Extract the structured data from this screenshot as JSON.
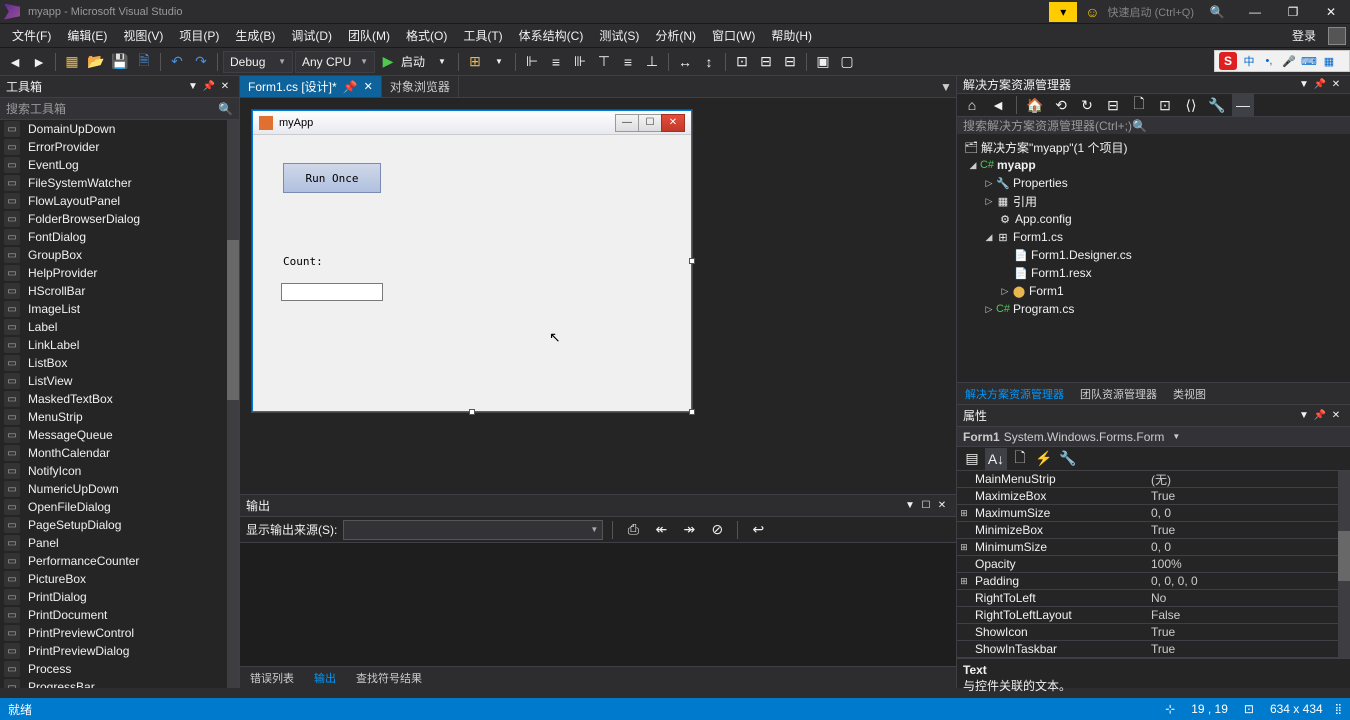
{
  "titlebar": {
    "title": "myapp - Microsoft Visual Studio",
    "quick_launch": "快速启动 (Ctrl+Q)"
  },
  "menu": {
    "items": [
      "文件(F)",
      "编辑(E)",
      "视图(V)",
      "项目(P)",
      "生成(B)",
      "调试(D)",
      "团队(M)",
      "格式(O)",
      "工具(T)",
      "体系结构(C)",
      "测试(S)",
      "分析(N)",
      "窗口(W)",
      "帮助(H)"
    ],
    "login": "登录"
  },
  "toolbar": {
    "config": "Debug",
    "platform": "Any CPU",
    "run": "启动"
  },
  "toolbox": {
    "header": "工具箱",
    "search": "搜索工具箱",
    "items": [
      "DomainUpDown",
      "ErrorProvider",
      "EventLog",
      "FileSystemWatcher",
      "FlowLayoutPanel",
      "FolderBrowserDialog",
      "FontDialog",
      "GroupBox",
      "HelpProvider",
      "HScrollBar",
      "ImageList",
      "Label",
      "LinkLabel",
      "ListBox",
      "ListView",
      "MaskedTextBox",
      "MenuStrip",
      "MessageQueue",
      "MonthCalendar",
      "NotifyIcon",
      "NumericUpDown",
      "OpenFileDialog",
      "PageSetupDialog",
      "Panel",
      "PerformanceCounter",
      "PictureBox",
      "PrintDialog",
      "PrintDocument",
      "PrintPreviewControl",
      "PrintPreviewDialog",
      "Process",
      "ProgressBar"
    ]
  },
  "tabs": {
    "active": "Form1.cs [设计]*",
    "inactive": "对象浏览器"
  },
  "winform": {
    "title": "myApp",
    "button": "Run Once",
    "label": "Count:"
  },
  "output": {
    "header": "输出",
    "source_label": "显示输出来源(S):"
  },
  "bottom_tabs": {
    "a": "错误列表",
    "b": "输出",
    "c": "查找符号结果"
  },
  "solution": {
    "header": "解决方案资源管理器",
    "search": "搜索解决方案资源管理器(Ctrl+;)",
    "root": "解决方案\"myapp\"(1 个项目)",
    "project": "myapp",
    "properties": "Properties",
    "references": "引用",
    "appconfig": "App.config",
    "form1cs": "Form1.cs",
    "designer": "Form1.Designer.cs",
    "resx": "Form1.resx",
    "form1": "Form1",
    "program": "Program.cs",
    "tabs": {
      "a": "解决方案资源管理器",
      "b": "团队资源管理器",
      "c": "类视图"
    }
  },
  "props": {
    "header": "属性",
    "object_name": "Form1",
    "object_type": "System.Windows.Forms.Form",
    "rows": [
      {
        "n": "MainMenuStrip",
        "v": "(无)",
        "e": ""
      },
      {
        "n": "MaximizeBox",
        "v": "True",
        "e": ""
      },
      {
        "n": "MaximumSize",
        "v": "0, 0",
        "e": "+"
      },
      {
        "n": "MinimizeBox",
        "v": "True",
        "e": ""
      },
      {
        "n": "MinimumSize",
        "v": "0, 0",
        "e": "+"
      },
      {
        "n": "Opacity",
        "v": "100%",
        "e": ""
      },
      {
        "n": "Padding",
        "v": "0, 0, 0, 0",
        "e": "+"
      },
      {
        "n": "RightToLeft",
        "v": "No",
        "e": ""
      },
      {
        "n": "RightToLeftLayout",
        "v": "False",
        "e": ""
      },
      {
        "n": "ShowIcon",
        "v": "True",
        "e": ""
      },
      {
        "n": "ShowInTaskbar",
        "v": "True",
        "e": ""
      }
    ],
    "desc_name": "Text",
    "desc_text": "与控件关联的文本。"
  },
  "statusbar": {
    "ready": "就绪",
    "pos": "19 , 19",
    "size": "634 x 434"
  },
  "ime": {
    "logo": "S",
    "zhong": "中"
  }
}
